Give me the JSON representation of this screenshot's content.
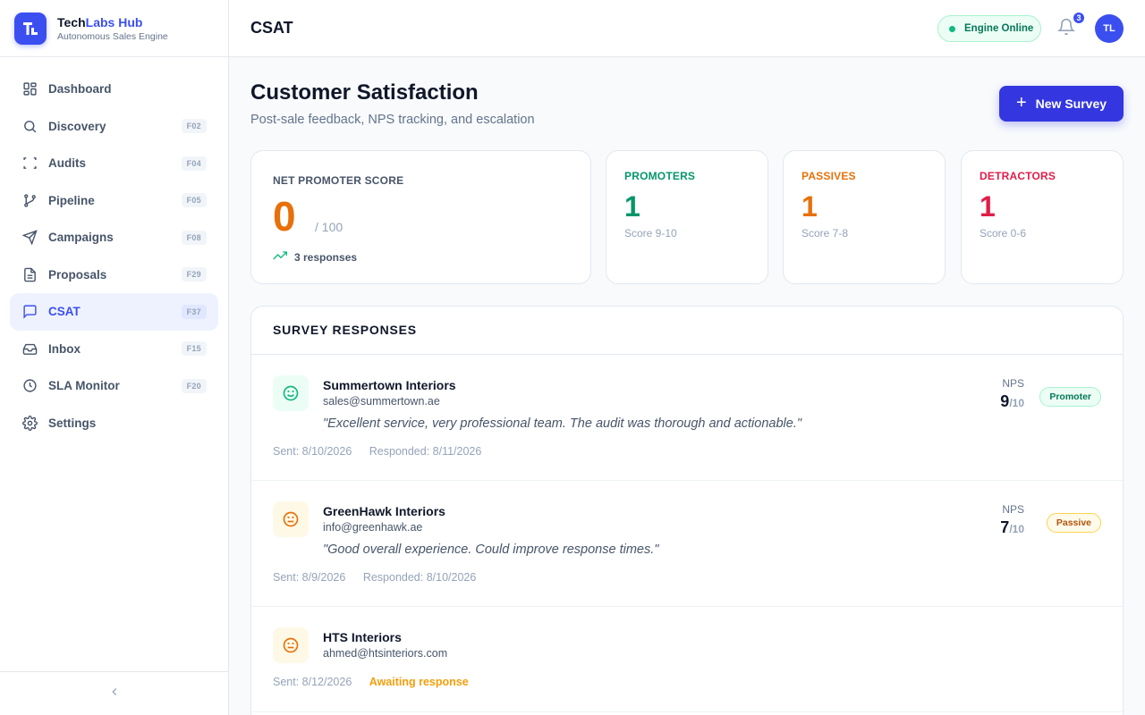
{
  "brand": {
    "name_part1": "Tech",
    "name_part2": "Labs Hub",
    "subtitle": "Autonomous Sales Engine",
    "logo_letter": "TL"
  },
  "nav": [
    {
      "label": "Dashboard",
      "key": "",
      "icon": "grid-icon"
    },
    {
      "label": "Discovery",
      "key": "F02",
      "icon": "search-icon"
    },
    {
      "label": "Audits",
      "key": "F04",
      "icon": "scan-icon"
    },
    {
      "label": "Pipeline",
      "key": "F05",
      "icon": "git-branch-icon"
    },
    {
      "label": "Campaigns",
      "key": "F08",
      "icon": "send-icon"
    },
    {
      "label": "Proposals",
      "key": "F29",
      "icon": "file-icon"
    },
    {
      "label": "CSAT",
      "key": "F37",
      "icon": "message-icon",
      "active": true
    },
    {
      "label": "Inbox",
      "key": "F15",
      "icon": "inbox-icon"
    },
    {
      "label": "SLA Monitor",
      "key": "F20",
      "icon": "clock-icon"
    },
    {
      "label": "Settings",
      "key": "",
      "icon": "gear-icon"
    }
  ],
  "topbar": {
    "title": "CSAT",
    "engine_status": "Engine Online",
    "notifications": "3",
    "avatar": "TL"
  },
  "page": {
    "title": "Customer Satisfaction",
    "subtitle": "Post-sale feedback, NPS tracking, and escalation",
    "new_button": "New Survey"
  },
  "nps": {
    "label": "NET PROMOTER SCORE",
    "value": "0",
    "max": "/ 100",
    "responses": "3 responses"
  },
  "stats": [
    {
      "label": "PROMOTERS",
      "value": "1",
      "range": "Score 9-10",
      "color": "#059669"
    },
    {
      "label": "PASSIVES",
      "value": "1",
      "range": "Score 7-8",
      "color": "#e8700a"
    },
    {
      "label": "DETRACTORS",
      "value": "1",
      "range": "Score 0-6",
      "color": "#e11d48"
    }
  ],
  "responses": {
    "header": "SURVEY RESPONSES",
    "nps_label": "NPS",
    "items": [
      {
        "company": "Summertown Interiors",
        "email": "sales@summertown.ae",
        "quote": "\"Excellent service, very professional team. The audit was thorough and actionable.\"",
        "sent": "Sent: 8/10/2026",
        "responded": "Responded: 8/11/2026",
        "score": "9",
        "score_max": "/10",
        "badge": "Promoter",
        "face": "smile-icon"
      },
      {
        "company": "GreenHawk Interiors",
        "email": "info@greenhawk.ae",
        "quote": "\"Good overall experience. Could improve response times.\"",
        "sent": "Sent: 8/9/2026",
        "responded": "Responded: 8/10/2026",
        "score": "7",
        "score_max": "/10",
        "badge": "Passive",
        "face": "neutral-face-icon"
      },
      {
        "company": "HTS Interiors",
        "email": "ahmed@htsinteriors.com",
        "sent": "Sent: 8/12/2026",
        "status": "Awaiting response",
        "face": "neutral-face-icon"
      }
    ]
  }
}
